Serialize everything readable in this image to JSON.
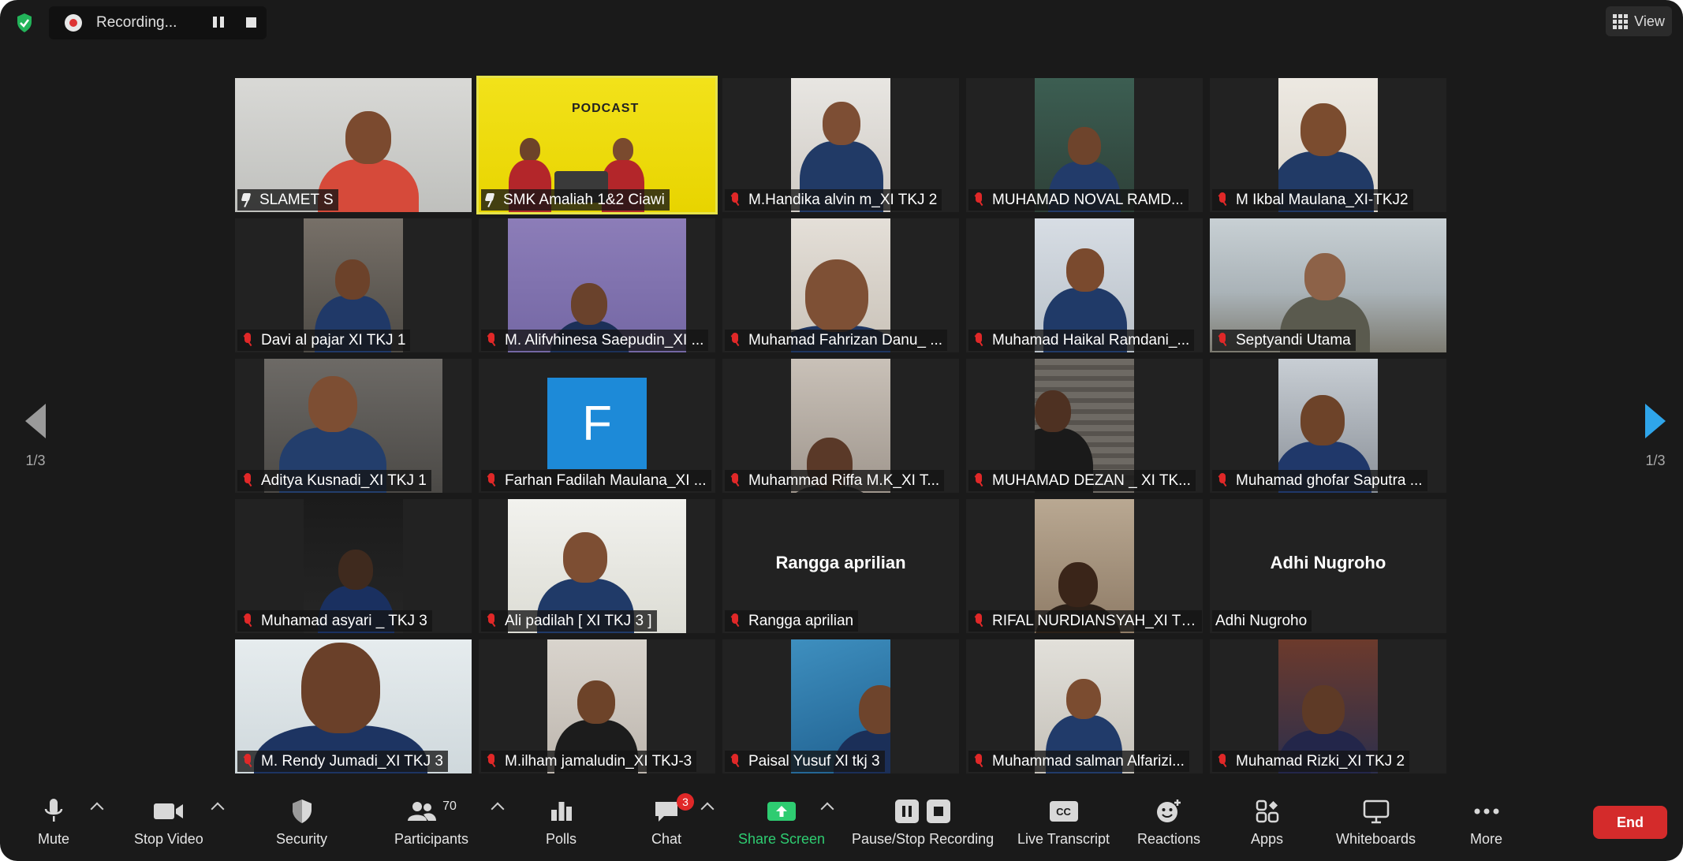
{
  "recording": {
    "status": "Recording..."
  },
  "view": {
    "label": "View"
  },
  "pager": {
    "left": "1/3",
    "right": "1/3"
  },
  "tiles": [
    {
      "name": "SLAMET S",
      "icon": "pin",
      "tile": "cam",
      "active": false
    },
    {
      "name": "SMK Amaliah 1&2 Ciawi",
      "icon": "pin",
      "tile": "podcast",
      "active": true
    },
    {
      "name": "M.Handika alvin m_XI TKJ 2",
      "icon": "muted",
      "tile": "cam"
    },
    {
      "name": "MUHAMAD NOVAL RAMD...",
      "icon": "muted",
      "tile": "cam"
    },
    {
      "name": "M Ikbal Maulana_XI-TKJ2",
      "icon": "muted",
      "tile": "cam"
    },
    {
      "name": "Davi al pajar XI TKJ 1",
      "icon": "muted",
      "tile": "cam"
    },
    {
      "name": "M. Alifvhinesa Saepudin_XI ...",
      "icon": "muted",
      "tile": "cam"
    },
    {
      "name": "Muhamad Fahrizan Danu_ ...",
      "icon": "muted",
      "tile": "cam"
    },
    {
      "name": "Muhamad Haikal Ramdani_...",
      "icon": "muted",
      "tile": "cam"
    },
    {
      "name": "Septyandi Utama",
      "icon": "muted",
      "tile": "cam"
    },
    {
      "name": "Aditya Kusnadi_XI TKJ 1",
      "icon": "muted",
      "tile": "cam"
    },
    {
      "name": "Farhan Fadilah Maulana_XI ...",
      "icon": "muted",
      "tile": "avatar",
      "avatar_letter": "F"
    },
    {
      "name": "Muhammad Riffa M.K_XI T...",
      "icon": "muted",
      "tile": "cam"
    },
    {
      "name": "MUHAMAD DEZAN _ XI TK...",
      "icon": "muted",
      "tile": "cam"
    },
    {
      "name": "Muhamad ghofar Saputra ...",
      "icon": "muted",
      "tile": "cam"
    },
    {
      "name": "Muhamad asyari _ TKJ 3",
      "icon": "muted",
      "tile": "cam"
    },
    {
      "name": "Ali padilah [ XI TKJ 3 ]",
      "icon": "muted",
      "tile": "cam"
    },
    {
      "name": "Rangga aprilian",
      "icon": "muted",
      "tile": "nametag",
      "display_name": "Rangga aprilian"
    },
    {
      "name": "RIFAL NURDIANSYAH_XI TK...",
      "icon": "muted",
      "tile": "cam"
    },
    {
      "name": "Adhi Nugroho",
      "icon": "none",
      "tile": "nametag",
      "display_name": "Adhi Nugroho"
    },
    {
      "name": "M. Rendy Jumadi_XI TKJ 3",
      "icon": "muted",
      "tile": "cam"
    },
    {
      "name": "M.ilham jamaludin_XI TKJ-3",
      "icon": "muted",
      "tile": "cam"
    },
    {
      "name": "Paisal Yusuf Xl tkj 3",
      "icon": "muted",
      "tile": "cam"
    },
    {
      "name": "Muhammad salman Alfarizi...",
      "icon": "muted",
      "tile": "cam"
    },
    {
      "name": "Muhamad Rizki_XI TKJ 2",
      "icon": "muted",
      "tile": "cam"
    }
  ],
  "podcast": {
    "sign": "PODCAST"
  },
  "toolbar": {
    "mute": "Mute",
    "stop_video": "Stop Video",
    "security": "Security",
    "participants": "Participants",
    "participants_count": "70",
    "polls": "Polls",
    "chat": "Chat",
    "chat_badge": "3",
    "share_screen": "Share Screen",
    "pause_stop_recording": "Pause/Stop Recording",
    "live_transcript": "Live Transcript",
    "cc_label": "CC",
    "reactions": "Reactions",
    "apps": "Apps",
    "whiteboards": "Whiteboards",
    "more": "More",
    "end": "End"
  },
  "colors": {
    "accent_green": "#2ecc71",
    "end_red": "#d42b2b",
    "active_speaker": "#e6e34a",
    "avatar_blue": "#1d8ad8"
  }
}
